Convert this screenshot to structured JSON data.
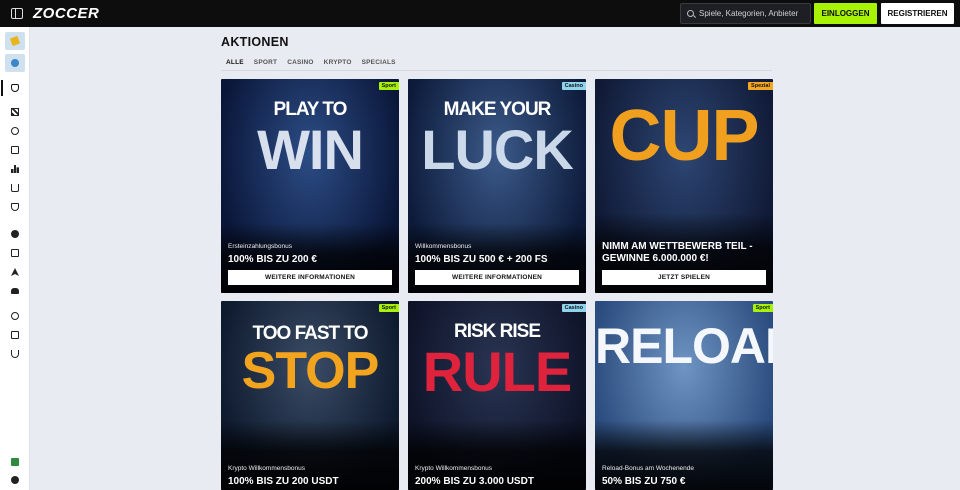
{
  "header": {
    "logo": "ZOCCER",
    "search_placeholder": "Spiele, Kategorien, Anbieter",
    "login_label": "EINLOGGEN",
    "register_label": "REGISTRIEREN"
  },
  "sidebar": {
    "items": [
      {
        "icon": "promo-icon"
      },
      {
        "icon": "globe-icon"
      },
      {
        "icon": "bag-icon"
      },
      {
        "icon": "checkered-flag-icon"
      },
      {
        "icon": "award-icon"
      },
      {
        "icon": "chart-icon"
      },
      {
        "icon": "podium-icon"
      },
      {
        "icon": "basket-icon"
      },
      {
        "icon": "shield-icon"
      },
      {
        "icon": "ball-icon"
      },
      {
        "icon": "ticket-icon"
      },
      {
        "icon": "rocket-icon"
      },
      {
        "icon": "car-icon"
      },
      {
        "icon": "coins-icon"
      },
      {
        "icon": "exchange-icon"
      },
      {
        "icon": "magnet-icon"
      },
      {
        "icon": "licence-icon"
      },
      {
        "icon": "help-icon"
      }
    ]
  },
  "main": {
    "title": "AKTIONEN",
    "tabs": [
      "ALLE",
      "SPORT",
      "CASINO",
      "KRYPTO",
      "SPECIALS"
    ],
    "active_tab": "ALLE"
  },
  "cards": [
    {
      "badge": "Sport",
      "badge_type": "sport",
      "art_text": [
        "PLAY TO",
        "WIN"
      ],
      "bg_from": "#0a1638",
      "bg_to": "#2c4d86",
      "accent": "#e8eef8",
      "subtitle": "Ersteinzahlungsbonus",
      "headline": "100% BIS ZU 200 €",
      "cta": "WEITERE INFORMATIONEN"
    },
    {
      "badge": "Casino",
      "badge_type": "casino",
      "art_text": [
        "MAKE YOUR",
        "LUCK"
      ],
      "bg_from": "#0d1b3a",
      "bg_to": "#3b5a8a",
      "accent": "#d9e6f5",
      "subtitle": "Willkommensbonus",
      "headline": "100% BIS ZU 500 € + 200 FS",
      "cta": "WEITERE INFORMATIONEN"
    },
    {
      "badge": "Spezial",
      "badge_type": "spezial",
      "art_text": [
        "",
        "CUP"
      ],
      "bg_from": "#101a36",
      "bg_to": "#2d4673",
      "accent": "#f0a01e",
      "subtitle": "",
      "headline": "NIMM AM WETTBEWERB TEIL - GEWINNE  6.000.000 €!",
      "cta": "JETZT SPIELEN"
    },
    {
      "badge": "Sport",
      "badge_type": "sport",
      "art_text": [
        "TOO FAST TO",
        "STOP"
      ],
      "bg_from": "#0e1a2e",
      "bg_to": "#3a4c66",
      "accent": "#f3a41e",
      "subtitle": "Krypto Willkommensbonus",
      "headline": "100% BIS ZU 200 USDT",
      "cta": ""
    },
    {
      "badge": "Casino",
      "badge_type": "casino",
      "art_text": [
        "RISK RISE",
        "RULE"
      ],
      "bg_from": "#0e1328",
      "bg_to": "#2a3553",
      "accent": "#e0233c",
      "subtitle": "Krypto Willkommensbonus",
      "headline": "200% BIS ZU 3.000 USDT",
      "cta": ""
    },
    {
      "badge": "Sport",
      "badge_type": "sport",
      "art_text": [
        "",
        "RELOAD"
      ],
      "bg_from": "#2a4b7d",
      "bg_to": "#6f95c4",
      "accent": "#f4f7fb",
      "subtitle": "Reload-Bonus am Wochenende",
      "headline": "50% BIS ZU 750 €",
      "cta": ""
    }
  ]
}
